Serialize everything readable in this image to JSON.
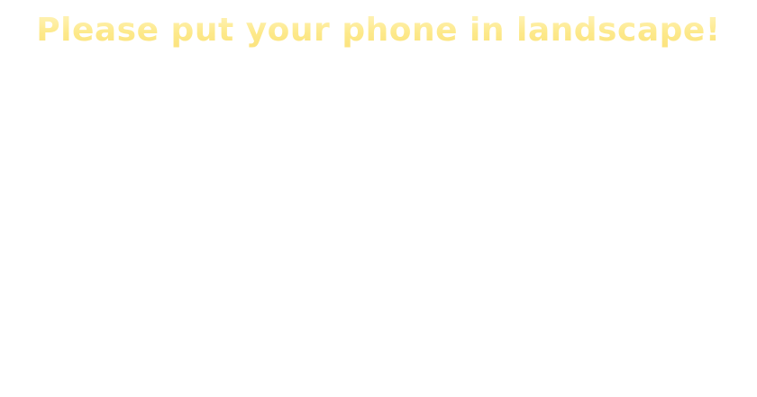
{
  "overlay": {
    "message": "Please put your phone in landscape!",
    "text_color_top": "#fff6c8",
    "text_color_bottom": "#fbe07a",
    "background": "#ffffff"
  }
}
